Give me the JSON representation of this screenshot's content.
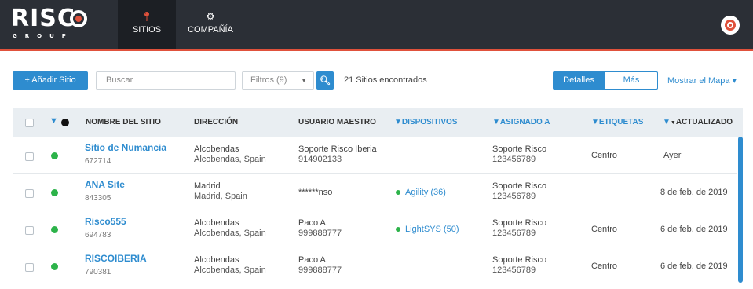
{
  "brand": {
    "logo_text": "RISC",
    "logo_sub": "GROUP"
  },
  "nav": {
    "tabs": [
      {
        "label": "SITIOS",
        "icon": "map-pin-icon",
        "active": true
      },
      {
        "label": "COMPAÑÍA",
        "icon": "gear-icon",
        "active": false
      }
    ]
  },
  "toolbar": {
    "add_label": "+ Añadir Sitio",
    "search_placeholder": "Buscar",
    "filters_label": "Filtros (9)",
    "search_icon": "search-icon",
    "found_text": "21 Sitios encontrados",
    "view_details": "Detalles",
    "view_more": "Más",
    "show_map": "Mostrar el Mapa"
  },
  "table": {
    "columns": {
      "name": "NOMBRE DEL SITIO",
      "address": "DIRECCIÓN",
      "master_user": "USUARIO MAESTRO",
      "devices": "DISPOSITIVOS",
      "assigned": "ASIGNADO A",
      "labels": "ETIQUETAS",
      "updated": "ACTUALIZADO"
    },
    "rows": [
      {
        "name": "Sitio de Numancia",
        "id": "672714",
        "addr1": "Alcobendas",
        "addr2": "Alcobendas, Spain",
        "user1": "Soporte Risco Iberia",
        "user2": "914902133",
        "device": "",
        "assigned1": "Soporte Risco",
        "assigned2": "123456789",
        "label": "Centro",
        "updated": "Ayer"
      },
      {
        "name": "ANA Site",
        "id": "843305",
        "addr1": "Madrid",
        "addr2": "Madrid, Spain",
        "user1": "******nso",
        "user2": "",
        "device": "Agility (36)",
        "assigned1": "Soporte Risco",
        "assigned2": "123456789",
        "label": "",
        "updated": "8 de feb. de 2019"
      },
      {
        "name": "Risco555",
        "id": "694783",
        "addr1": "Alcobendas",
        "addr2": "Alcobendas, Spain",
        "user1": "Paco A.",
        "user2": "999888777",
        "device": "LightSYS (50)",
        "assigned1": "Soporte Risco",
        "assigned2": "123456789",
        "label": "Centro",
        "updated": "6 de feb. de 2019"
      },
      {
        "name": "RISCOIBERIA",
        "id": "790381",
        "addr1": "Alcobendas",
        "addr2": "Alcobendas, Spain",
        "user1": "Paco A.",
        "user2": "999888777",
        "device": "",
        "assigned1": "Soporte Risco",
        "assigned2": "123456789",
        "label": "Centro",
        "updated": "6 de feb. de 2019"
      }
    ]
  },
  "colors": {
    "accent": "#2e8ccf",
    "brand_red": "#e0513b",
    "status_online": "#2db34a",
    "topbar": "#2b2f36"
  }
}
